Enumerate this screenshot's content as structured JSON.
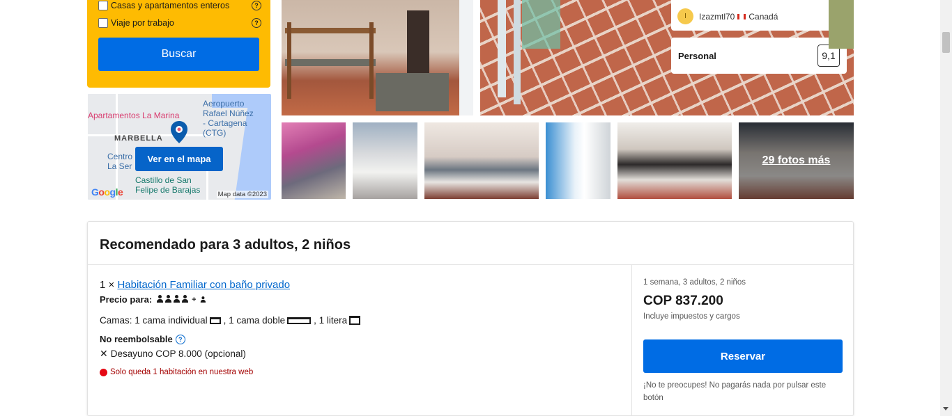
{
  "search": {
    "filters": [
      {
        "label": "Casas y apartamentos enteros",
        "help": "?"
      },
      {
        "label": "Viaje por trabajo",
        "help": "?"
      }
    ],
    "button_label": "Buscar"
  },
  "map": {
    "labels": {
      "apartamentos": "Apartamentos La Marina",
      "aeropuerto_1": "Aeropuerto",
      "aeropuerto_2": "Rafael Núñez",
      "aeropuerto_3": "- Cartagena",
      "aeropuerto_4": "(CTG)",
      "marbella": "MARBELLA",
      "centro_1": "Centro",
      "centro_2": "La Ser",
      "castillo_1": "Castillo de San",
      "castillo_2": "Felipe de Barajas",
      "google": "Google",
      "footer": "Map data ©2023"
    },
    "button_label": "Ver en el mapa"
  },
  "gallery": {
    "more_photos_label": "29 fotos más"
  },
  "review": {
    "avatar_letter": "I",
    "reviewer": "Izazmtl70",
    "country": "Canadá",
    "category": "Personal",
    "score": "9,1"
  },
  "recommendation": {
    "title": "Recomendado para 3 adultos, 2 niños",
    "room_qty": "1 ×",
    "room_name": "Habitación Familiar con baño privado",
    "price_for_label": "Precio para:",
    "plus": "+",
    "beds_label": "Camas: 1 cama individual",
    "beds_part2": ", 1 cama doble",
    "beds_part3": ", 1 litera",
    "cancellation": "No reembolsable",
    "breakfast": "Desayuno COP 8.000 (opcional)",
    "scarcity": "Solo queda 1 habitación en nuestra web",
    "stay_summary": "1 semana, 3 adultos, 2 niños",
    "price": "COP 837.200",
    "taxes_note": "Incluye impuestos y cargos",
    "reserve_label": "Reservar",
    "reassurance": "¡No te preocupes! No pagarás nada por pulsar este botón"
  }
}
